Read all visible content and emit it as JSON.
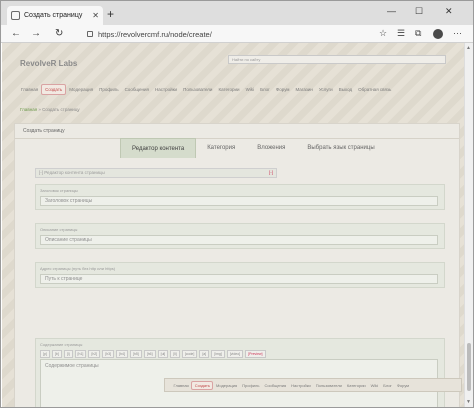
{
  "browser": {
    "tab_title": "Создать страницу",
    "tab_close": "✕",
    "new_tab": "+",
    "win_min": "—",
    "win_max": "☐",
    "win_close": "✕",
    "back": "←",
    "forward": "→",
    "reload": "↻",
    "url": "https://revolvercmf.ru/node/create/",
    "star": "☆",
    "collections": "☰",
    "extensions": "⧉",
    "menu": "···"
  },
  "site": {
    "logo": "RevolveR Labs",
    "search_placeholder": "Найти по сайту"
  },
  "nav": {
    "items": [
      {
        "label": "Главная",
        "active": false
      },
      {
        "label": "Создать",
        "active": true
      },
      {
        "label": "Модерация",
        "active": false
      },
      {
        "label": "Профиль",
        "active": false
      },
      {
        "label": "Сообщения",
        "active": false
      },
      {
        "label": "Настройки",
        "active": false
      },
      {
        "label": "Пользователи",
        "active": false
      },
      {
        "label": "Категории",
        "active": false
      },
      {
        "label": "Wiki",
        "active": false
      },
      {
        "label": "Блог",
        "active": false
      },
      {
        "label": "Форум",
        "active": false
      },
      {
        "label": "Магазин",
        "active": false
      },
      {
        "label": "Услуги",
        "active": false
      },
      {
        "label": "Выход",
        "active": false
      },
      {
        "label": "Обратная связь",
        "active": false
      }
    ]
  },
  "breadcrumb": {
    "home": "Главная",
    "sep": " » ",
    "current": "Создать страницу"
  },
  "panel": {
    "title": "Создать страницу"
  },
  "form_tabs": [
    {
      "label": "Редактор контента",
      "active": true
    },
    {
      "label": "Категория",
      "active": false
    },
    {
      "label": "Вложения",
      "active": false
    },
    {
      "label": "Выбрать язык страницы",
      "active": false
    }
  ],
  "editor": {
    "label": "[-] Редактор контента страницы",
    "toggle": "[-]"
  },
  "fields": {
    "title": {
      "label": "Заголовок страницы",
      "placeholder": "Заголовок страницы"
    },
    "description": {
      "label": "Описание страницы",
      "placeholder": "Описание страницы"
    },
    "path": {
      "label": "Адрес страницы (путь без http или https)",
      "placeholder": "Путь к странице"
    },
    "content": {
      "label": "Содержание страницы",
      "placeholder": "Содержимое страницы"
    }
  },
  "bbcodes": [
    "[p]",
    "[b]",
    "[i]",
    "[h1]",
    "[h2]",
    "[h3]",
    "[h4]",
    "[h5]",
    "[h6]",
    "[ul]",
    "[li]",
    "[code]",
    "[a]",
    "[img]",
    "[video]"
  ],
  "preview_button": "[Preview]",
  "bottom_nav": {
    "items": [
      {
        "label": "Главная",
        "active": false
      },
      {
        "label": "Создать",
        "active": true
      },
      {
        "label": "Модерация",
        "active": false
      },
      {
        "label": "Профиль",
        "active": false
      },
      {
        "label": "Сообщения",
        "active": false
      },
      {
        "label": "Настройки",
        "active": false
      },
      {
        "label": "Пользователи",
        "active": false
      },
      {
        "label": "Категории",
        "active": false
      },
      {
        "label": "Wiki",
        "active": false
      },
      {
        "label": "Блог",
        "active": false
      },
      {
        "label": "Форум",
        "active": false
      }
    ]
  }
}
